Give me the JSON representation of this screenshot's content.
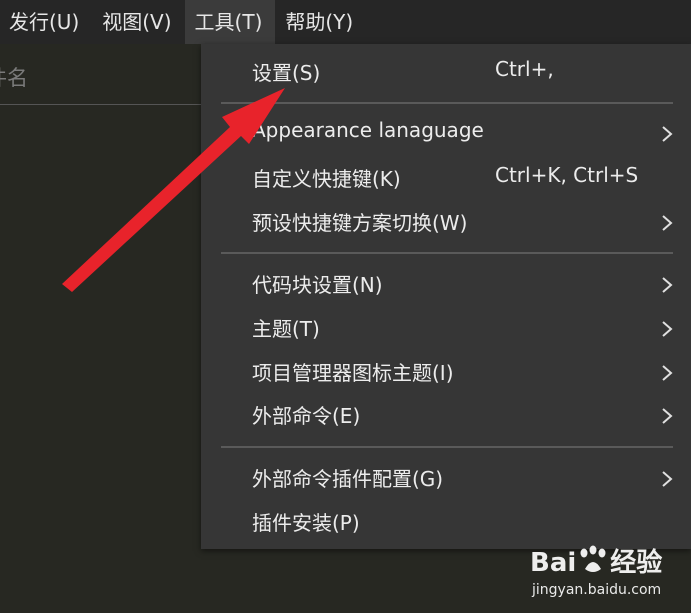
{
  "menubar": {
    "items": [
      {
        "label": "发行(U)"
      },
      {
        "label": "视图(V)"
      },
      {
        "label": "工具(T)"
      },
      {
        "label": "帮助(Y)"
      }
    ]
  },
  "sidebar": {
    "filename_label": "件名"
  },
  "tools_menu": {
    "items": [
      {
        "label": "设置(S)",
        "shortcut": "Ctrl+,"
      },
      {
        "label": "Appearance lanaguage",
        "shortcut": ""
      },
      {
        "label": "自定义快捷键(K)",
        "shortcut": "Ctrl+K, Ctrl+S"
      },
      {
        "label": "预设快捷键方案切换(W)",
        "shortcut": ""
      },
      {
        "label": "代码块设置(N)",
        "shortcut": ""
      },
      {
        "label": "主题(T)",
        "shortcut": ""
      },
      {
        "label": "项目管理器图标主题(I)",
        "shortcut": ""
      },
      {
        "label": "外部命令(E)",
        "shortcut": ""
      },
      {
        "label": "外部命令插件配置(G)",
        "shortcut": ""
      },
      {
        "label": "插件安装(P)",
        "shortcut": ""
      }
    ]
  },
  "watermark": {
    "logo_text_left": "Bai",
    "logo_text_right": "经验",
    "site": "jingyan.baidu.com"
  },
  "colors": {
    "background": "#272822",
    "menubar": "#262626",
    "dropdown": "#363636",
    "annotation_arrow": "#e8232b"
  }
}
